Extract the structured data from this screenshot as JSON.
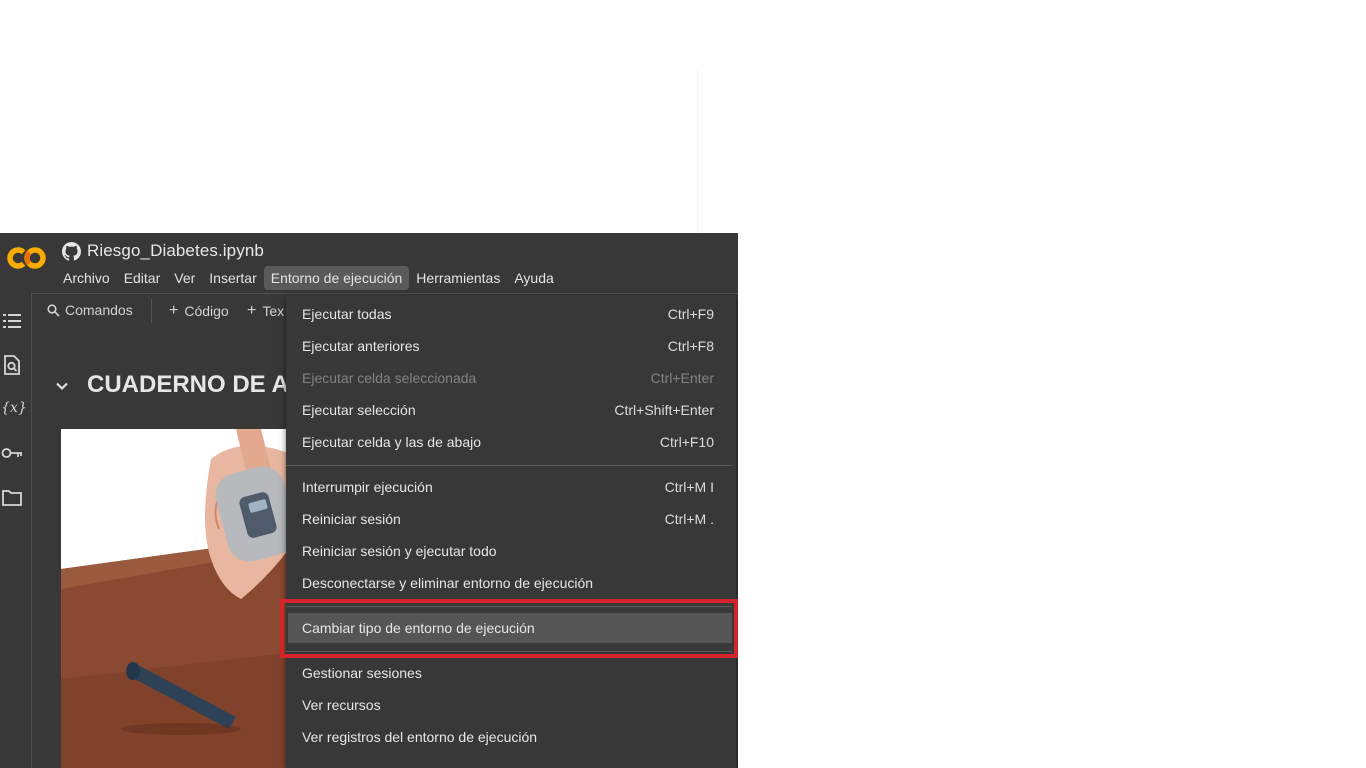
{
  "notebook": {
    "title": "Riesgo_Diabetes.ipynb"
  },
  "menubar": [
    "Archivo",
    "Editar",
    "Ver",
    "Insertar",
    "Entorno de ejecución",
    "Herramientas",
    "Ayuda"
  ],
  "toolbar": {
    "commands": "Comandos",
    "code": "Código",
    "text": "Tex"
  },
  "content": {
    "heading": "CUADERNO DE A"
  },
  "runtime_menu": {
    "items": [
      {
        "label": "Ejecutar todas",
        "shortcut": "Ctrl+F9",
        "disabled": false
      },
      {
        "label": "Ejecutar anteriores",
        "shortcut": "Ctrl+F8",
        "disabled": false
      },
      {
        "label": "Ejecutar celda seleccionada",
        "shortcut": "Ctrl+Enter",
        "disabled": true
      },
      {
        "label": "Ejecutar selección",
        "shortcut": "Ctrl+Shift+Enter",
        "disabled": false
      },
      {
        "label": "Ejecutar celda y las de abajo",
        "shortcut": "Ctrl+F10",
        "disabled": false
      },
      {
        "label": "Interrumpir ejecución",
        "shortcut": "Ctrl+M I",
        "disabled": false
      },
      {
        "label": "Reiniciar sesión",
        "shortcut": "Ctrl+M .",
        "disabled": false
      },
      {
        "label": "Reiniciar sesión y ejecutar todo",
        "shortcut": "",
        "disabled": false
      },
      {
        "label": "Desconectarse y eliminar entorno de ejecución",
        "shortcut": "",
        "disabled": false
      },
      {
        "label": "Cambiar tipo de entorno de ejecución",
        "shortcut": "",
        "disabled": false,
        "highlighted": true
      },
      {
        "label": "Gestionar sesiones",
        "shortcut": "",
        "disabled": false
      },
      {
        "label": "Ver recursos",
        "shortcut": "",
        "disabled": false
      },
      {
        "label": "Ver registros del entorno de ejecución",
        "shortcut": "",
        "disabled": false
      }
    ]
  },
  "sidebar_icons": [
    "table-of-contents-icon",
    "find-replace-icon",
    "variables-icon",
    "secrets-key-icon",
    "files-folder-icon"
  ],
  "sidebar_variables_glyph": "{x}",
  "colors": {
    "background": "#383838",
    "highlight_border": "#d6222a",
    "colab_orange": "#f9ab00",
    "colab_dark_orange": "#e8710a"
  }
}
